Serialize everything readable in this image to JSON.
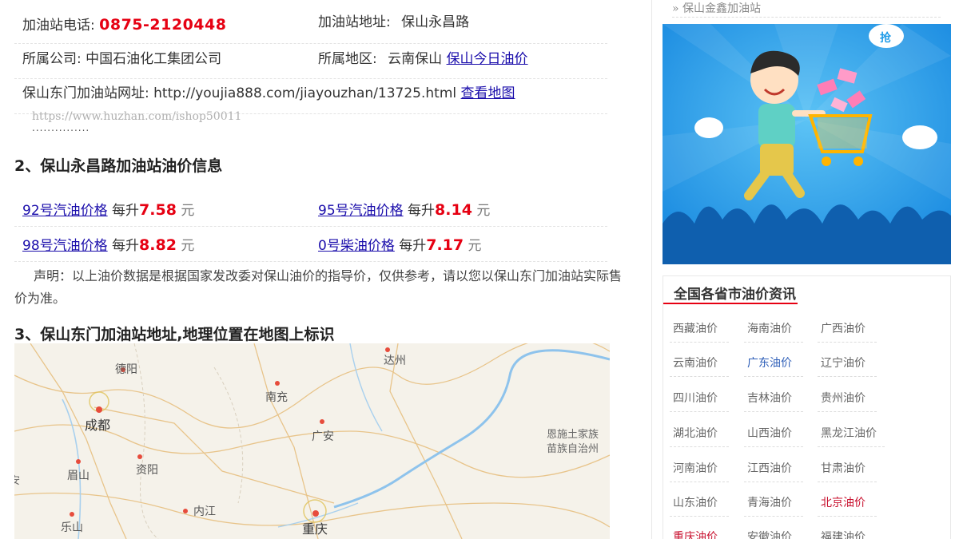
{
  "info": {
    "phone_label": "加油站电话:",
    "phone": "0875-2120448",
    "address_label": "加油站地址:",
    "address": "保山永昌路",
    "company_label": "所属公司:",
    "company": "中国石油化工集团公司",
    "region_label": "所属地区:",
    "region": "云南保山",
    "region_link": "保山今日油价",
    "url_label": "保山东门加油站网址:",
    "url": "http://youjia888.com/jiayouzhan/13725.html",
    "map_link": "查看地图",
    "watermark": "https://www.huzhan.com/ishop50011",
    "dots": "..............."
  },
  "section2": {
    "title": "2、保山永昌路加油站油价信息",
    "per_liter": "每升",
    "unit": "元",
    "prices": [
      {
        "name": "92号汽油价格",
        "value": "7.58"
      },
      {
        "name": "95号汽油价格",
        "value": "8.14"
      },
      {
        "name": "98号汽油价格",
        "value": "8.82"
      },
      {
        "name": "0号柴油价格",
        "value": "7.17"
      }
    ],
    "disclaimer": "声明：以上油价数据是根据国家发改委对保山油价的指导价，仅供参考，请以您以保山东门加油站实际售价为准。"
  },
  "section3": {
    "title": "3、保山东门加油站地址,地理位置在地图上标识"
  },
  "map": {
    "cities": [
      "德阳",
      "成都",
      "眉山",
      "资阳",
      "乐山",
      "内江",
      "南充",
      "广安",
      "达州",
      "重庆"
    ],
    "region_label_1": "恩施土家族",
    "region_label_2": "苗族自治州",
    "edge_label": "安"
  },
  "sidebar": {
    "top_item": "» 保山金鑫加油站",
    "banner_tag": "抢",
    "box_title": "全国各省市油价资讯",
    "provinces": [
      [
        "西藏油价",
        "海南油价",
        "广西油价"
      ],
      [
        "云南油价",
        "广东油价",
        "辽宁油价"
      ],
      [
        "四川油价",
        "吉林油价",
        "贵州油价"
      ],
      [
        "湖北油价",
        "山西油价",
        "黑龙江油价"
      ],
      [
        "河南油价",
        "江西油价",
        "甘肃油价"
      ],
      [
        "山东油价",
        "青海油价",
        "北京油价"
      ],
      [
        "重庆油价",
        "安徽油价",
        "福建油价"
      ]
    ]
  },
  "colors": {
    "price_red": "#e60012",
    "link_blue": "#1a0dab",
    "banner_blue": "#1e9be8"
  }
}
